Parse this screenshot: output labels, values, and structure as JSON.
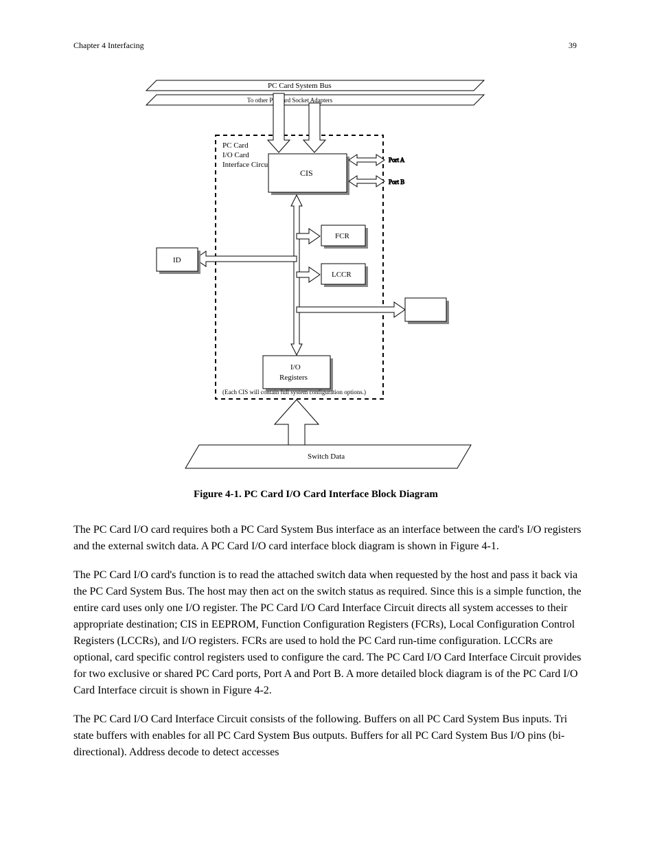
{
  "header": {
    "left": "Chapter 4 Interfacing",
    "right": "39"
  },
  "fig": {
    "caption": "Figure 4-1.  PC Card I/O Card Interface Block Diagram"
  },
  "top_bus": {
    "label_top": "PC Card System Bus",
    "label_bottom": "To other PC Card Socket Adapters"
  },
  "interface_block": {
    "line1": "PC Card",
    "line2": "I/O Card",
    "line3": "Interface Circuit",
    "note": "(Each CIS will contain full system configuration options.)"
  },
  "ports": {
    "a": "Port A",
    "b": "Port B"
  },
  "cis": {
    "label": "CIS"
  },
  "fcr": {
    "label": "FCR"
  },
  "lccr": {
    "label": "LCCR"
  },
  "id": {
    "label": "ID"
  },
  "io_reg": {
    "line1": "I/O",
    "line2": "Registers"
  },
  "switch": {
    "label": "Switch Data"
  },
  "body": {
    "p1": "The PC Card I/O card requires both a PC Card System Bus interface as an interface between the card's I/O registers and the external switch data. A PC Card I/O card interface block diagram is shown in Figure 4-1.",
    "p2": "The PC Card I/O card's function is to read the attached switch data when requested by the host and pass it back via the PC Card System Bus. The host may then act on the switch status as required. Since this is a simple function, the entire card uses only one I/O register. The PC Card I/O Card Interface Circuit directs all system accesses to their appropriate destination; CIS in EEPROM, Function Configuration Registers (FCRs), Local Configuration Control Registers (LCCRs), and I/O registers. FCRs are used to hold the PC Card run-time configuration. LCCRs are optional, card specific control registers used to configure the card. The PC Card I/O Card Interface Circuit provides for two exclusive or shared PC Card ports, Port A and Port B. A more detailed block diagram is of the PC Card I/O Card Interface circuit is shown in Figure 4-2.",
    "p3": "The PC Card I/O Card Interface Circuit consists of the following. Buffers on all PC Card System Bus inputs. Tri state buffers with enables for all PC Card System Bus outputs. Buffers for all PC Card System Bus I/O pins (bi-directional). Address decode to detect accesses"
  }
}
